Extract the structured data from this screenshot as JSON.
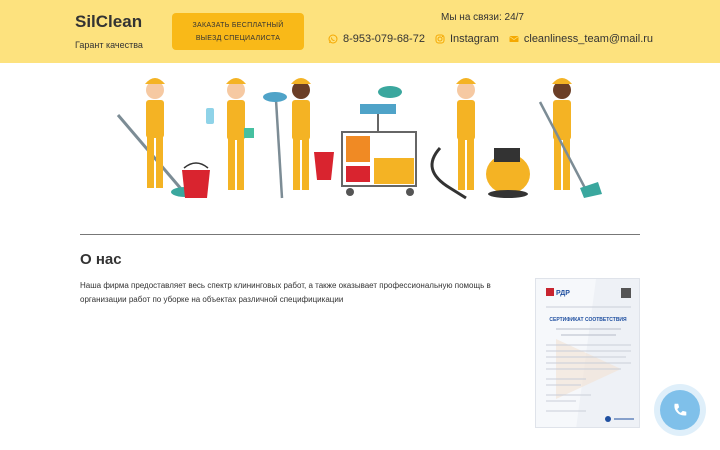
{
  "header": {
    "brand": "SilClean",
    "tagline": "Гарант качества",
    "order_button": "ЗАКАЗАТЬ БЕСПЛАТНЫЙ ВЫЕЗД СПЕЦИАЛИСТА",
    "contact_title": "Мы на связи: 24/7",
    "phone": "8-953-079-68-72",
    "instagram": "Instagram",
    "email": "cleanliness_team@mail.ru"
  },
  "about": {
    "title": "О нас",
    "text": "Наша фирма предоставляет весь спектр клининговых работ, а также оказывает профессиональную помощь в организации работ по уборке на объектах различной специфицикации"
  },
  "certificate": {
    "logo": "РДР",
    "title": "СЕРТИФИКАТ СООТВЕТСТВИЯ"
  },
  "icons": {
    "phone": "whatsapp-icon",
    "instagram": "instagram-icon",
    "email": "envelope-icon",
    "call": "phone-icon"
  },
  "colors": {
    "header_bg": "#fde27e",
    "button_bg": "#f9b918",
    "call_button": "#7fc0ea",
    "icon_accent": "#f5a800"
  }
}
